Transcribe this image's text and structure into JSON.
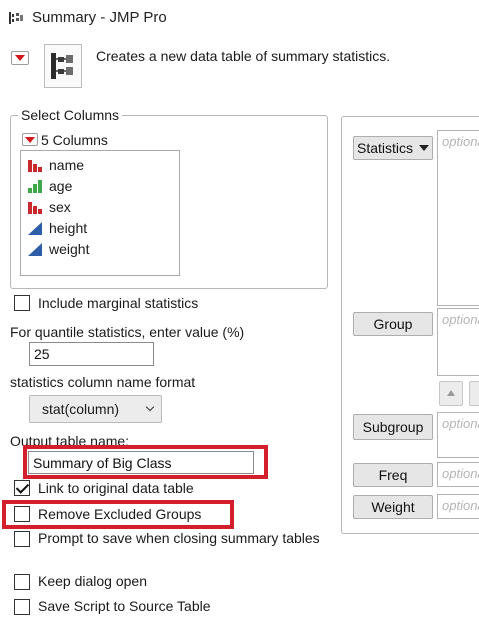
{
  "window": {
    "title": "Summary - JMP Pro"
  },
  "header": {
    "description": "Creates a new data table of summary statistics."
  },
  "select_columns": {
    "legend": "Select Columns",
    "count_label": "5 Columns",
    "items": [
      {
        "label": "name",
        "icon": "nominal-icon"
      },
      {
        "label": "age",
        "icon": "ordinal-icon"
      },
      {
        "label": "sex",
        "icon": "nominal-icon"
      },
      {
        "label": "height",
        "icon": "continuous-icon"
      },
      {
        "label": "weight",
        "icon": "continuous-icon"
      }
    ]
  },
  "options": {
    "include_marginal": {
      "label": "Include marginal statistics",
      "checked": false
    },
    "quantile_label": "For quantile statistics, enter value (%)",
    "quantile_value": "25",
    "name_format_label": "statistics column name format",
    "name_format_value": "stat(column)",
    "output_name_label": "Output table name:",
    "output_name_value": "Summary of Big Class",
    "link_original": {
      "label": "Link to original data table",
      "checked": true
    },
    "remove_excluded": {
      "label": "Remove Excluded Groups",
      "checked": false
    },
    "prompt_save": {
      "label": "Prompt to save when closing summary tables",
      "checked": false
    },
    "keep_open": {
      "label": "Keep dialog open",
      "checked": false
    },
    "save_script": {
      "label": "Save Script to Source Table",
      "checked": false
    }
  },
  "roles": {
    "statistics": {
      "label": "Statistics",
      "placeholder": "optional"
    },
    "group": {
      "label": "Group",
      "placeholder": "optional"
    },
    "subgroup": {
      "label": "Subgroup",
      "placeholder": "optional"
    },
    "freq": {
      "label": "Freq",
      "placeholder": "optional"
    },
    "weight": {
      "label": "Weight",
      "placeholder": "optional"
    }
  },
  "colors": {
    "highlight": "#d31e2c",
    "nominal": "#c9282d",
    "ordinal": "#3fa84a",
    "continuous": "#2f5ea8"
  }
}
